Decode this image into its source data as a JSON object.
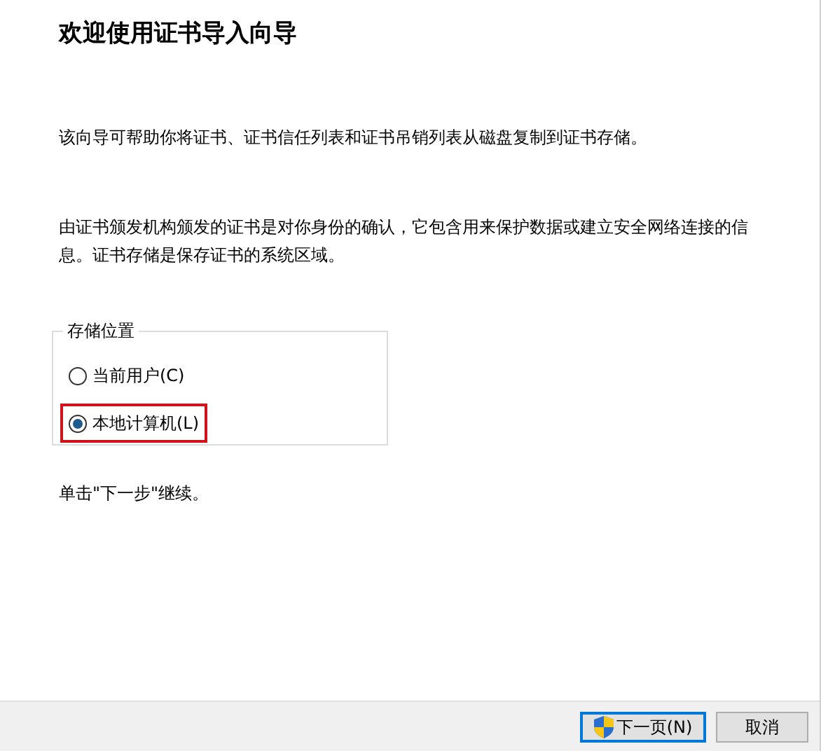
{
  "title": "欢迎使用证书导入向导",
  "paragraphs": [
    "该向导可帮助你将证书、证书信任列表和证书吊销列表从磁盘复制到证书存储。",
    "由证书颁发机构颁发的证书是对你身份的确认，它包含用来保护数据或建立安全网络连接的信息。证书存储是保存证书的系统区域。"
  ],
  "store_location": {
    "label": "存储位置",
    "options": [
      {
        "label": "当前用户(C)",
        "selected": false
      },
      {
        "label": "本地计算机(L)",
        "selected": true
      }
    ]
  },
  "hint": "单击\"下一步\"继续。",
  "buttons": [
    {
      "label": "下一页(N)",
      "kind": "default"
    },
    {
      "label": "取消",
      "kind": "normal"
    }
  ]
}
